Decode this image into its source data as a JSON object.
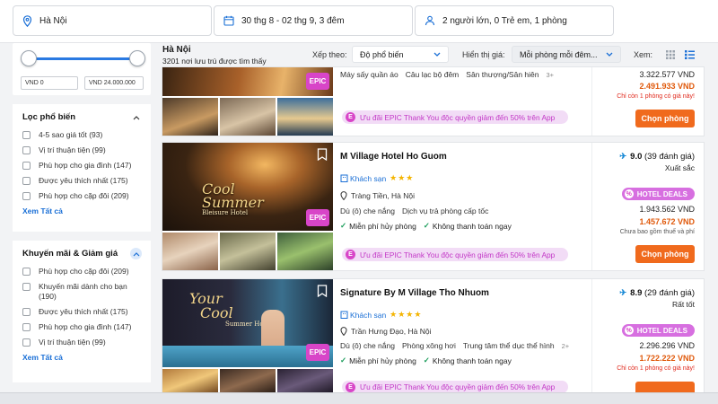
{
  "search": {
    "location": "Hà Nội",
    "dates": "30 thg 8 - 02 thg 9, 3 đêm",
    "guests": "2 người lớn, 0 Trẻ em, 1 phòng"
  },
  "sidebar": {
    "price_min": "VND 0",
    "price_max": "VND 24.000.000",
    "popular": {
      "title": "Lọc phổ biến",
      "items": [
        "4-5 sao giá tốt (93)",
        "Vị trí thuận tiện (99)",
        "Phù hợp cho gia đình (147)",
        "Được yêu thích nhất (175)",
        "Phù hợp cho cặp đôi (209)"
      ],
      "see_all": "Xem Tất cả"
    },
    "promo": {
      "title": "Khuyến mãi & Giảm giá",
      "items": [
        "Phù hợp cho cặp đôi (209)",
        "Khuyến mãi dành cho bạn (190)",
        "Được yêu thích nhất (175)",
        "Phù hợp cho gia đình (147)",
        "Vị trí thuận tiện (99)"
      ],
      "see_all": "Xem Tất cả"
    }
  },
  "results": {
    "location": "Hà Nội",
    "count": "3201 nơi lưu trú được tìm thấy",
    "sort_label": "Xếp theo:",
    "sort_value": "Độ phổ biến",
    "show_price_label": "Hiển thị giá:",
    "show_price_value": "Mỗi phòng mỗi đêm...",
    "view_label": "Xem:"
  },
  "hotels": [
    {
      "amenities": [
        "Máy sấy quần áo",
        "Câu lạc bộ đêm",
        "Sân thượng/Sân hiên"
      ],
      "amenities_more": "3+",
      "promo": "Ưu đãi EPIC Thank You độc quyền giảm đến 50% trên App",
      "epic": "EPIC",
      "price_old": "3.322.577 VND",
      "price_new": "2.491.933 VND",
      "note": "Chỉ còn 1 phòng có giá này!",
      "cta": "Chọn phòng"
    },
    {
      "name": "M Village Hotel Ho Guom",
      "type": "Khách sạn",
      "stars": "★★★",
      "address": "Tràng Tiền, Hà Nội",
      "amenities": [
        "Dù (ô) che nắng",
        "Dịch vụ trả phòng cấp tốc"
      ],
      "perks": [
        "Miễn phí hủy phòng",
        "Không thanh toán ngay"
      ],
      "promo": "Ưu đãi EPIC Thank You độc quyền giảm đến 50% trên App",
      "epic": "EPIC",
      "photo_text_1": "Cool",
      "photo_text_2": "Summer",
      "photo_text_3": "Bleisure Hotel",
      "score": "9.0",
      "reviews": "(39 đánh giá)",
      "rating_word": "Xuất sắc",
      "deal_badge": "HOTEL DEALS",
      "price_old": "1.943.562 VND",
      "price_new": "1.457.672 VND",
      "note": "Chưa bao gồm thuế và phí",
      "cta": "Chọn phòng"
    },
    {
      "name": "Signature By M Village Tho Nhuom",
      "type": "Khách sạn",
      "stars": "★★★★",
      "address": "Trần Hưng Đạo, Hà Nội",
      "amenities": [
        "Dù (ô) che nắng",
        "Phòng xông hơi",
        "Trung tâm thể dục thể hình"
      ],
      "amenities_more": "2+",
      "perks": [
        "Miễn phí hủy phòng",
        "Không thanh toán ngay"
      ],
      "promo": "Ưu đãi EPIC Thank You độc quyền giảm đến 50% trên App",
      "epic": "EPIC",
      "photo_text_1": "Your",
      "photo_text_2": "Cool",
      "photo_text_3": "Summer Hotel",
      "score": "8.9",
      "reviews": "(29 đánh giá)",
      "rating_word": "Rất tốt",
      "deal_badge": "HOTEL DEALS",
      "price_old": "2.296.296 VND",
      "price_new": "1.722.222 VND",
      "note": "Chỉ còn 1 phòng có giá này!"
    }
  ],
  "colors": {
    "accent_blue": "#1a6fd6",
    "cta_orange": "#f06a1d",
    "price_orange": "#e0590b",
    "epic_pink": "#d845c8"
  }
}
